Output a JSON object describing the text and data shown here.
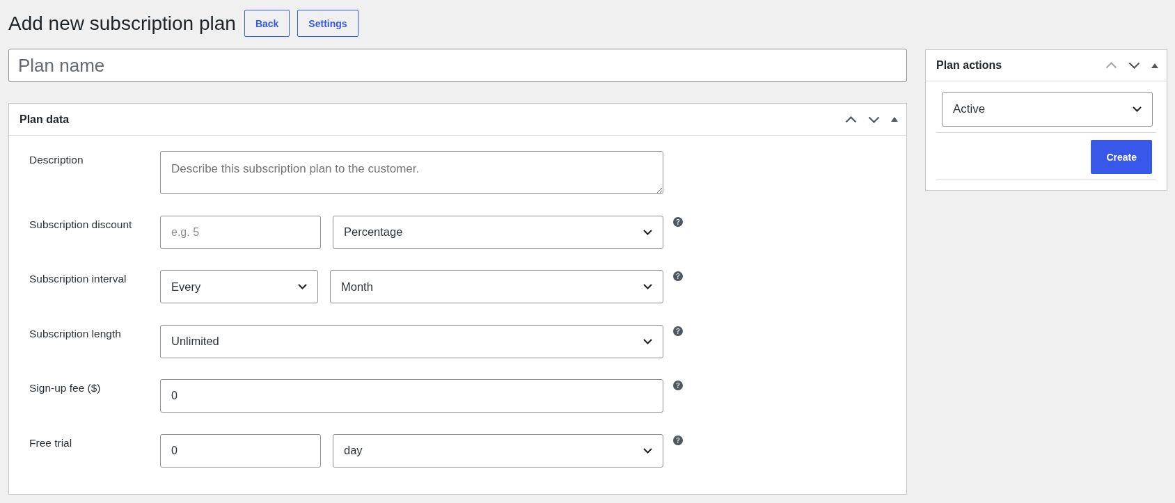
{
  "page": {
    "title": "Add new subscription plan",
    "buttons": [
      {
        "label": "Back"
      },
      {
        "label": "Settings"
      }
    ]
  },
  "plan_name": {
    "placeholder": "Plan name"
  },
  "plan_data": {
    "title": "Plan data",
    "move_up_disabled": false,
    "move_down_disabled": false,
    "expanded": true,
    "rows": [
      {
        "label": "Description",
        "help": false,
        "fields": [
          {
            "kind": "textarea",
            "placeholder": "Describe this subscription plan to the customer."
          }
        ]
      },
      {
        "label": "Subscription discount",
        "help": true,
        "fields": [
          {
            "kind": "input",
            "placeholder": "e.g. 5"
          },
          {
            "kind": "select",
            "value": "Percentage"
          }
        ]
      },
      {
        "label": "Subscription interval",
        "help": true,
        "fields": [
          {
            "kind": "select",
            "value": "Every"
          },
          {
            "kind": "select",
            "value": "Month"
          }
        ]
      },
      {
        "label": "Subscription length",
        "help": true,
        "fields": [
          {
            "kind": "select",
            "value": "Unlimited"
          }
        ]
      },
      {
        "label": "Sign-up fee ($)",
        "help": true,
        "fields": [
          {
            "kind": "input",
            "value": "0"
          }
        ]
      },
      {
        "label": "Free trial",
        "help": true,
        "fields": [
          {
            "kind": "input",
            "value": "0"
          },
          {
            "kind": "select",
            "value": "day"
          }
        ]
      }
    ]
  },
  "plan_actions": {
    "title": "Plan actions",
    "move_up_disabled": true,
    "move_down_disabled": false,
    "expanded": true,
    "status": {
      "value": "Active"
    },
    "button": {
      "label": "Create"
    }
  }
}
